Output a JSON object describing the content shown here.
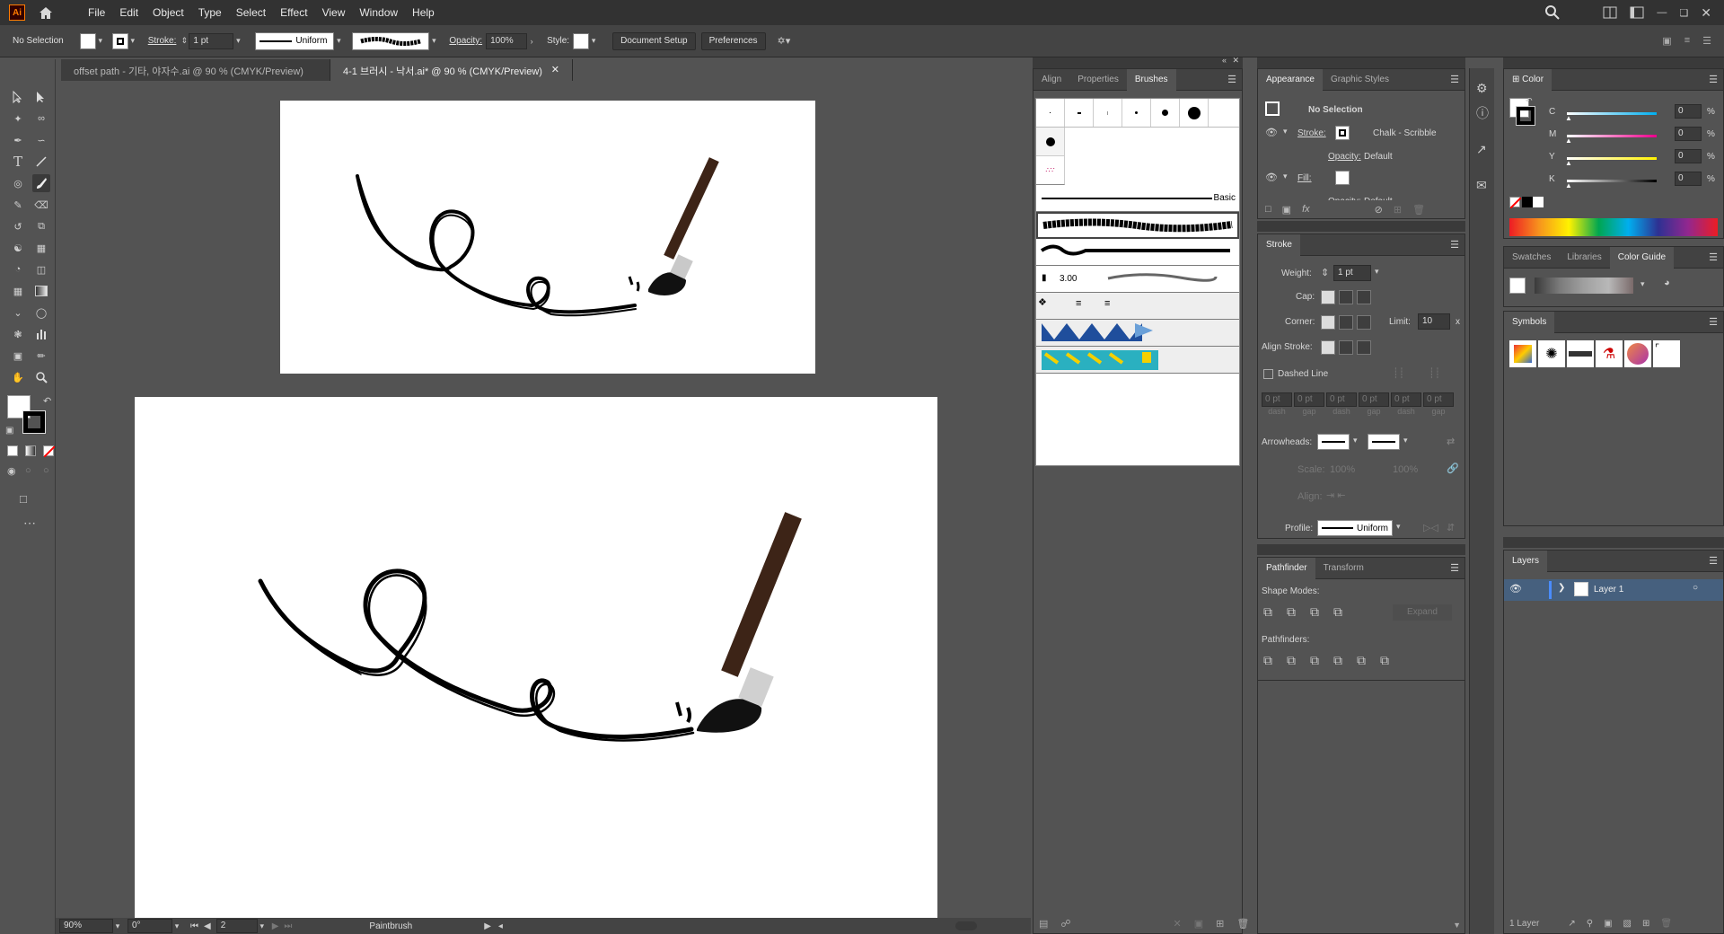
{
  "menubar": {
    "logo": "Ai",
    "items": [
      "File",
      "Edit",
      "Object",
      "Type",
      "Select",
      "Effect",
      "View",
      "Window",
      "Help"
    ]
  },
  "controlbar": {
    "selection": "No Selection",
    "stroke_label": "Stroke:",
    "stroke_weight": "1 pt",
    "profile": "Uniform",
    "opacity_label": "Opacity:",
    "opacity_value": "100%",
    "style_label": "Style:",
    "document_setup": "Document Setup",
    "preferences": "Preferences"
  },
  "doc_tabs": [
    {
      "label": "offset path - 기타, 야자수.ai @ 90 % (CMYK/Preview)",
      "active": false
    },
    {
      "label": "4-1 브러시 - 낙서.ai* @ 90 % (CMYK/Preview)",
      "active": true
    }
  ],
  "statusbar": {
    "zoom": "90%",
    "rotation": "0°",
    "artboard": "2",
    "tool": "Paintbrush"
  },
  "brushes_panel": {
    "tabs": [
      "Align",
      "Properties",
      "Brushes"
    ],
    "active_tab": "Brushes",
    "basic_label": "Basic",
    "size_label": "3.00"
  },
  "appearance_panel": {
    "tabs": [
      "Appearance",
      "Graphic Styles"
    ],
    "title": "No Selection",
    "stroke_label": "Stroke:",
    "stroke_value": "Chalk - Scribble",
    "opacity_label": "Opacity:",
    "opacity_value": "Default",
    "fill_label": "Fill:",
    "opacity2_label": "Opacity:",
    "opacity2_value": "Default"
  },
  "stroke_panel": {
    "title": "Stroke",
    "weight_label": "Weight:",
    "weight_value": "1 pt",
    "cap_label": "Cap:",
    "corner_label": "Corner:",
    "limit_label": "Limit:",
    "limit_value": "10",
    "limit_unit": "x",
    "align_label": "Align Stroke:",
    "dashed_label": "Dashed Line",
    "dash_values": [
      "0 pt",
      "0 pt",
      "0 pt",
      "0 pt",
      "0 pt",
      "0 pt"
    ],
    "dash_labels": [
      "dash",
      "gap",
      "dash",
      "gap",
      "dash",
      "gap"
    ],
    "arrowheads_label": "Arrowheads:",
    "scale_label": "Scale:",
    "scale_values": [
      "100%",
      "100%"
    ],
    "align2_label": "Align:",
    "profile_label": "Profile:",
    "profile_value": "Uniform"
  },
  "pathfinder_panel": {
    "tabs": [
      "Pathfinder",
      "Transform"
    ],
    "shape_modes": "Shape Modes:",
    "expand": "Expand",
    "pathfinders": "Pathfinders:"
  },
  "color_panel": {
    "title": "Color",
    "channels": [
      {
        "label": "C",
        "value": "0",
        "unit": "%",
        "color": "#00aeef"
      },
      {
        "label": "M",
        "value": "0",
        "unit": "%",
        "color": "#ec008c"
      },
      {
        "label": "Y",
        "value": "0",
        "unit": "%",
        "color": "#fff200"
      },
      {
        "label": "K",
        "value": "0",
        "unit": "%",
        "color": "#000000"
      }
    ]
  },
  "swatches_panel": {
    "tabs": [
      "Swatches",
      "Libraries",
      "Color Guide"
    ],
    "active_tab": "Color Guide"
  },
  "symbols_panel": {
    "title": "Symbols"
  },
  "layers_panel": {
    "title": "Layers",
    "layer_name": "Layer 1",
    "footer_count": "1 Layer"
  }
}
